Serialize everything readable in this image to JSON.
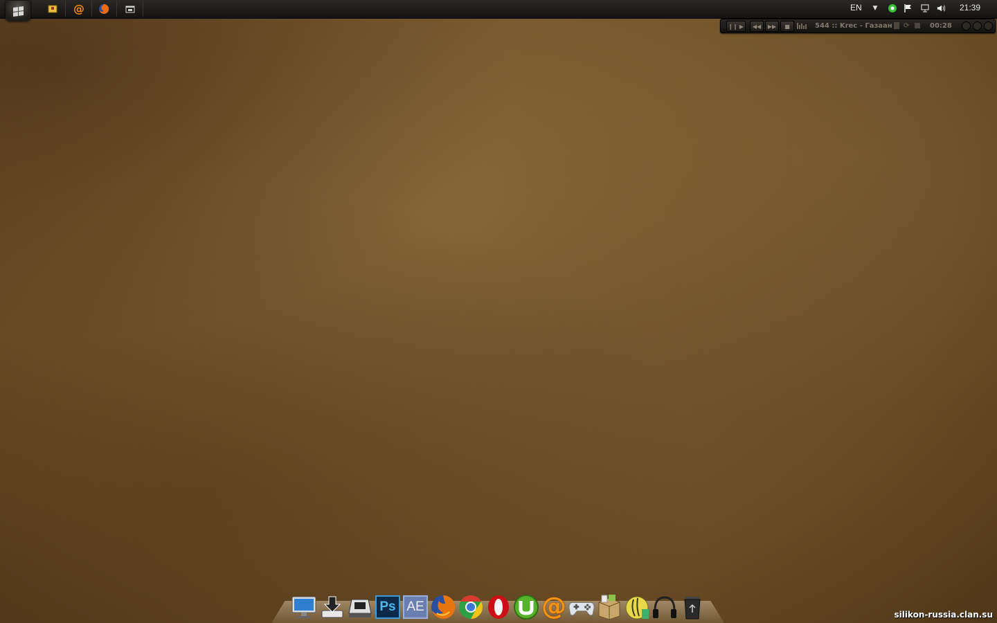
{
  "taskbar": {
    "quick_launch": [
      {
        "name": "archive-icon",
        "color": "#e8c040"
      },
      {
        "name": "mail-agent-icon",
        "color": "#f08a10"
      },
      {
        "name": "firefox-icon",
        "color": "#e86b10"
      },
      {
        "name": "explorer-window-icon",
        "color": "#cfcfcf"
      }
    ],
    "tray": {
      "language": "EN",
      "clock": "21:39"
    }
  },
  "player": {
    "track": "544 :: Krec - Газаан",
    "time": "00:28"
  },
  "dock": {
    "items": [
      {
        "name": "my-computer-icon"
      },
      {
        "name": "downloads-icon"
      },
      {
        "name": "drive-icon"
      },
      {
        "name": "photoshop-icon",
        "label": "Ps"
      },
      {
        "name": "after-effects-icon",
        "label": "AE"
      },
      {
        "name": "firefox-icon"
      },
      {
        "name": "chrome-icon"
      },
      {
        "name": "opera-icon"
      },
      {
        "name": "utorrent-icon"
      },
      {
        "name": "mail-agent-icon",
        "label": "@"
      },
      {
        "name": "gamepad-icon"
      },
      {
        "name": "box-icon"
      },
      {
        "name": "fl-studio-icon"
      },
      {
        "name": "headphones-icon"
      },
      {
        "name": "recycle-bin-icon"
      }
    ]
  },
  "watermark": "silikon-russia.clan.su"
}
